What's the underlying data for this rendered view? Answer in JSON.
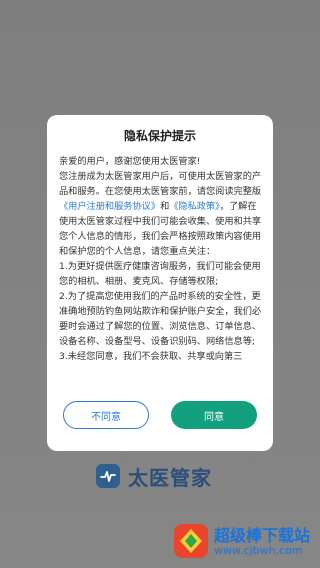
{
  "dialog": {
    "title": "隐私保护提示",
    "greeting": "亲爱的用户，感谢您使用太医管家!",
    "para1_a": "您注册成为太医管家用户后，可使用太医管家的产品和服务。在您使用太医管家前，请您阅读完整版",
    "link_terms": "《用户注册和服务协议》",
    "and_text": "和",
    "link_privacy": "《隐私政策》",
    "para1_b": "，了解在使用太医管家过程中我们可能会收集、使用和共享您个人信息的情形，我们会严格按照政策内容使用和保护您的个人信息，请您重点关注：",
    "item1": "1.为更好提供医疗健康咨询服务，我们可能会使用您的相机、相册、麦克风、存储等权限;",
    "item2": "2.为了提高您使用我们的产品时系统的安全性，更准确地预防钓鱼网站欺诈和保护账户安全，我们必要时会通过了解您的位置、浏览信息、订单信息、设备名称、设备型号、设备识别码、网络信息等;",
    "item3": "3.未经您同意，我们不会获取、共享或向第三",
    "disagree_label": "不同意",
    "agree_label": "同意"
  },
  "brand": {
    "name": "太医管家",
    "logo_icon": "heart-pulse-icon"
  },
  "watermark": {
    "title": "超级棒下载站",
    "url": "www.cjbwh.com",
    "logo_icon": "download-site-icon"
  },
  "colors": {
    "link": "#2e7ad6",
    "agree_button": "#13a07f",
    "brand_text": "#2c4f7a"
  }
}
